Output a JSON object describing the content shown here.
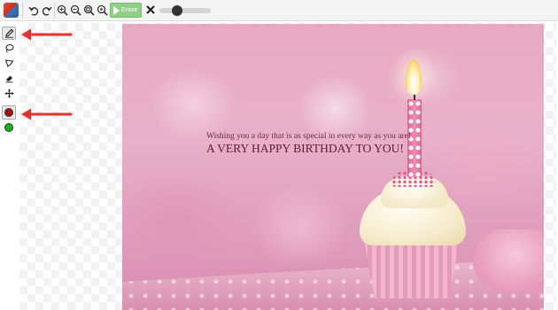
{
  "toolbar": {
    "logo": "app-logo-icon",
    "undo_icon": "undo-icon",
    "redo_icon": "redo-icon",
    "zoom_in_icon": "zoom-in-icon",
    "zoom_out_icon": "zoom-out-icon",
    "zoom_fit_icon": "zoom-fit-icon",
    "zoom_reset_icon": "zoom-reset-icon",
    "erase_label": "Erase",
    "clear_icon": "close-icon",
    "brush_size_fraction": 0.3
  },
  "side_tools": {
    "items": [
      {
        "icon": "pencil-icon",
        "active": true
      },
      {
        "icon": "lasso-icon",
        "active": false
      },
      {
        "icon": "polygon-lasso-icon",
        "active": false
      },
      {
        "icon": "eraser-icon",
        "active": false
      },
      {
        "icon": "move-icon",
        "active": false
      }
    ],
    "colors": [
      {
        "name": "foreground-color",
        "value": "#a00f12",
        "active": true
      },
      {
        "name": "background-color",
        "value": "#15b515",
        "active": false
      }
    ]
  },
  "annotations": {
    "arrow_color": "#e0332e"
  },
  "image": {
    "wish_line": "Wishing you a day that is as special in every way as you are!",
    "birthday_line": "A VERY HAPPY BIRTHDAY TO YOU!"
  }
}
